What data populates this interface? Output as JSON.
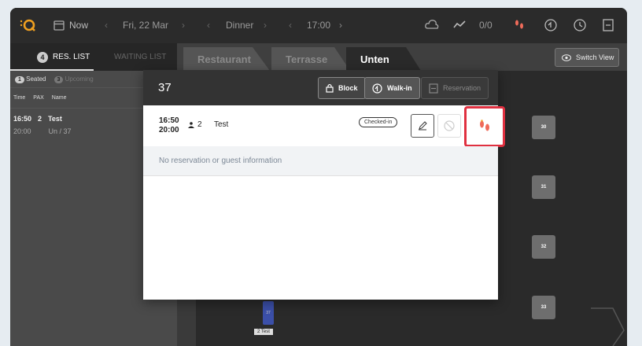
{
  "topbar": {
    "now_label": "Now",
    "date": "Fri, 22 Mar",
    "service": "Dinner",
    "time": "17:00",
    "counter": "0/0"
  },
  "subbar": {
    "res_list_count": "4",
    "res_list_label": "RES. LIST",
    "waiting_list_label": "WAITING LIST"
  },
  "sidebar": {
    "seated_count": "1",
    "seated_label": "Seated",
    "upcoming_count": "3",
    "upcoming_label": "Upcoming",
    "cols": [
      "Time",
      "PAX",
      "Name"
    ],
    "row": {
      "time": "16:50",
      "pax": "2",
      "name": "Test",
      "end": "20:00",
      "table": "Un / 37"
    }
  },
  "floor": {
    "tabs": [
      "Restaurant",
      "Terrasse",
      "Unten"
    ],
    "switch_view": "Switch View",
    "tables": [
      "30",
      "31",
      "32",
      "33"
    ],
    "chip_table": "37",
    "chip_label": "2   Test"
  },
  "modal": {
    "title": "37",
    "block_label": "Block",
    "walkin_label": "Walk-in",
    "reservation_label": "Reservation",
    "start_time": "16:50",
    "end_time": "20:00",
    "pax": "2",
    "guest_name": "Test",
    "status": "Checked-in",
    "info": "No reservation or guest information"
  },
  "colors": {
    "highlight": "#e03040",
    "accent_orange": "#f0a020",
    "footprint": "#ef6b5a"
  }
}
